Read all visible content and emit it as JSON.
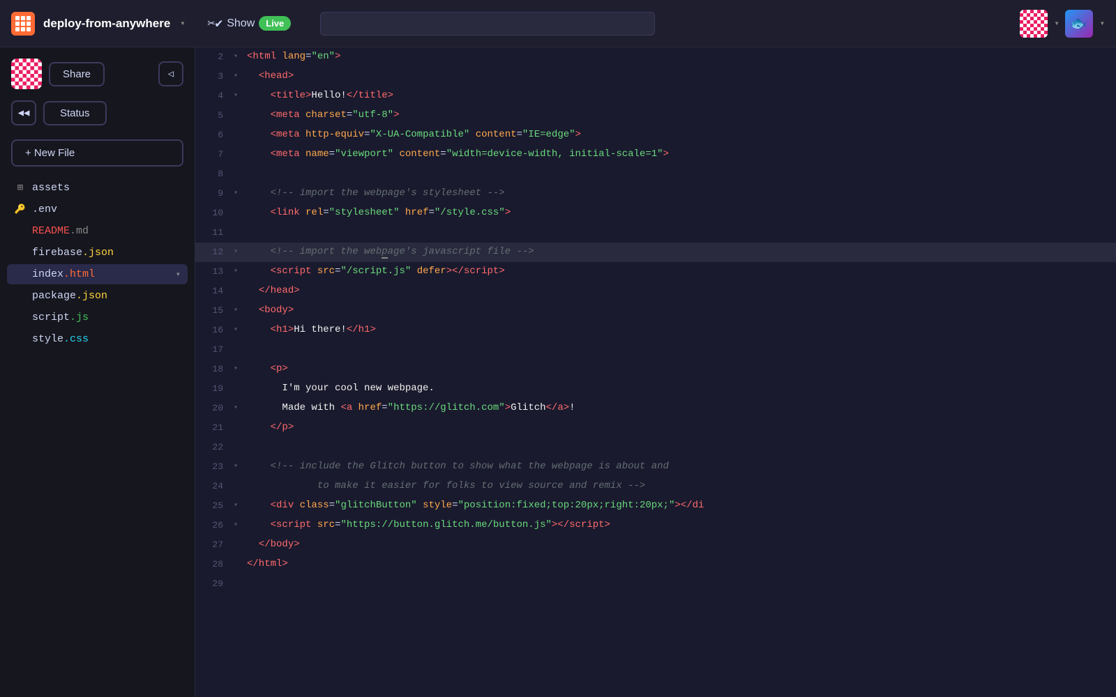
{
  "topbar": {
    "logo_alt": "Glitch logo",
    "project_name": "deploy-from-anywhere",
    "show_label": "Show",
    "live_label": "Live",
    "search_placeholder": "",
    "avatar1_alt": "User avatar checkerboard",
    "avatar2_alt": "Fish avatar"
  },
  "sidebar": {
    "share_label": "Share",
    "collapse_icon": "◁",
    "back_icon": "◀◀",
    "status_label": "Status",
    "new_file_label": "+ New File",
    "files": [
      {
        "id": "assets",
        "icon": "grid",
        "name": "assets",
        "ext": ""
      },
      {
        "id": "env",
        "icon": "key",
        "name": ".env",
        "ext": ""
      },
      {
        "id": "readme",
        "icon": "",
        "name": "README",
        "ext": ".md",
        "ext_class": "ext-red"
      },
      {
        "id": "firebase",
        "icon": "",
        "name": "firebase",
        "ext": ".json",
        "ext_class": "ext-yellow"
      },
      {
        "id": "index",
        "icon": "",
        "name": "index",
        "ext": ".html",
        "ext_class": "ext-orange",
        "active": true
      },
      {
        "id": "package",
        "icon": "",
        "name": "package",
        "ext": ".json",
        "ext_class": "ext-yellow"
      },
      {
        "id": "script",
        "icon": "",
        "name": "script",
        "ext": ".js",
        "ext_class": "ext-green"
      },
      {
        "id": "style",
        "icon": "",
        "name": "style",
        "ext": ".css",
        "ext_class": "ext-cyan"
      }
    ]
  },
  "editor": {
    "lines": [
      {
        "num": 2,
        "arrow": "▾",
        "content": "&lt;html lang=&quot;en&quot;&gt;",
        "highlighted": false
      },
      {
        "num": 3,
        "arrow": "▾",
        "content": "  &lt;head&gt;",
        "highlighted": false
      },
      {
        "num": 4,
        "arrow": "▾",
        "content": "    &lt;title&gt;Hello!&lt;/title&gt;",
        "highlighted": false
      },
      {
        "num": 5,
        "arrow": "",
        "content": "    &lt;meta charset=&quot;utf-8&quot;&gt;",
        "highlighted": false
      },
      {
        "num": 6,
        "arrow": "",
        "content": "    &lt;meta http-equiv=&quot;X-UA-Compatible&quot; content=&quot;IE=edge&quot;&gt;",
        "highlighted": false
      },
      {
        "num": 7,
        "arrow": "",
        "content": "    &lt;meta name=&quot;viewport&quot; content=&quot;width=device-width, initial-scale=1&quot;&gt;",
        "highlighted": false
      },
      {
        "num": 8,
        "arrow": "",
        "content": "",
        "highlighted": false
      },
      {
        "num": 9,
        "arrow": "▾",
        "content": "    &lt;!-- import the webpage's stylesheet --&gt;",
        "highlighted": false
      },
      {
        "num": 10,
        "arrow": "",
        "content": "    &lt;link rel=&quot;stylesheet&quot; href=&quot;/style.css&quot;&gt;",
        "highlighted": false
      },
      {
        "num": 11,
        "arrow": "",
        "content": "",
        "highlighted": false
      },
      {
        "num": 12,
        "arrow": "▾",
        "content": "    &lt;!-- import the webpage's javascript file --&gt;",
        "highlighted": true
      },
      {
        "num": 13,
        "arrow": "▾",
        "content": "    &lt;script src=&quot;/script.js&quot; defer&gt;&lt;/script&gt;",
        "highlighted": false
      },
      {
        "num": 14,
        "arrow": "",
        "content": "  &lt;/head&gt;",
        "highlighted": false
      },
      {
        "num": 15,
        "arrow": "▾",
        "content": "  &lt;body&gt;",
        "highlighted": false
      },
      {
        "num": 16,
        "arrow": "▾",
        "content": "    &lt;h1&gt;Hi there!&lt;/h1&gt;",
        "highlighted": false
      },
      {
        "num": 17,
        "arrow": "",
        "content": "",
        "highlighted": false
      },
      {
        "num": 18,
        "arrow": "▾",
        "content": "    &lt;p&gt;",
        "highlighted": false
      },
      {
        "num": 19,
        "arrow": "",
        "content": "      I'm your cool new webpage.",
        "highlighted": false
      },
      {
        "num": 20,
        "arrow": "▾",
        "content": "      Made with &lt;a href=&quot;https://glitch.com&quot;&gt;Glitch&lt;/a&gt;!",
        "highlighted": false
      },
      {
        "num": 21,
        "arrow": "",
        "content": "    &lt;/p&gt;",
        "highlighted": false
      },
      {
        "num": 22,
        "arrow": "",
        "content": "",
        "highlighted": false
      },
      {
        "num": 23,
        "arrow": "▾",
        "content": "    &lt;!-- include the Glitch button to show what the webpage is about and",
        "highlighted": false
      },
      {
        "num": 24,
        "arrow": "",
        "content": "            to make it easier for folks to view source and remix --&gt;",
        "highlighted": false
      },
      {
        "num": 25,
        "arrow": "▾",
        "content": "    &lt;div class=&quot;glitchButton&quot; style=&quot;position:fixed;top:20px;right:20px;&quot;&gt;&lt;/di",
        "highlighted": false
      },
      {
        "num": 26,
        "arrow": "▾",
        "content": "    &lt;script src=&quot;https://button.glitch.me/button.js&quot;&gt;&lt;/script&gt;",
        "highlighted": false
      },
      {
        "num": 27,
        "arrow": "",
        "content": "  &lt;/body&gt;",
        "highlighted": false
      },
      {
        "num": 28,
        "arrow": "",
        "content": "&lt;/html&gt;",
        "highlighted": false
      },
      {
        "num": 29,
        "arrow": "",
        "content": "",
        "highlighted": false
      }
    ]
  }
}
